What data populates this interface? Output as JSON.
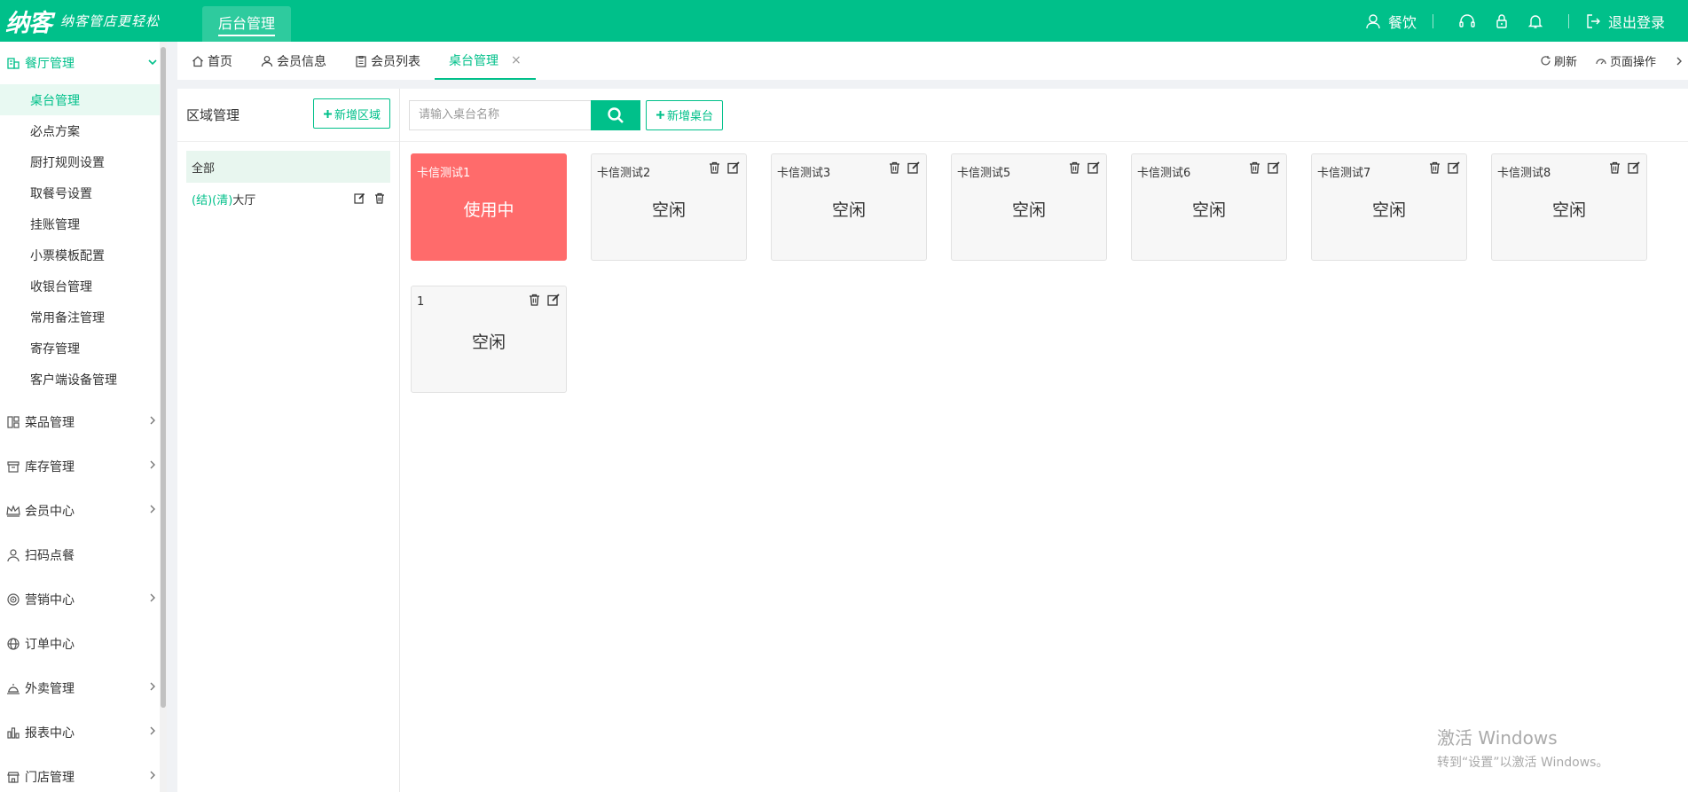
{
  "topbar": {
    "logo": "纳客",
    "slogan": "纳客管店更轻松",
    "module_tab": "后台管理",
    "user_label": "餐饮",
    "logout_label": "退出登录"
  },
  "sidebar": {
    "open_group": "餐厅管理",
    "sub_items": [
      {
        "label": "桌台管理",
        "active": true
      },
      {
        "label": "必点方案"
      },
      {
        "label": "厨打规则设置"
      },
      {
        "label": "取餐号设置"
      },
      {
        "label": "挂账管理"
      },
      {
        "label": "小票模板配置"
      },
      {
        "label": "收银台管理"
      },
      {
        "label": "常用备注管理"
      },
      {
        "label": "寄存管理"
      },
      {
        "label": "客户端设备管理"
      }
    ],
    "groups": [
      {
        "label": "菜品管理",
        "icon": "layout-icon"
      },
      {
        "label": "库存管理",
        "icon": "box-icon"
      },
      {
        "label": "会员中心",
        "icon": "crown-icon"
      },
      {
        "label": "扫码点餐",
        "icon": "person-icon"
      },
      {
        "label": "营销中心",
        "icon": "target-icon"
      },
      {
        "label": "订单中心",
        "icon": "globe-icon"
      },
      {
        "label": "外卖管理",
        "icon": "bell-dome-icon"
      },
      {
        "label": "报表中心",
        "icon": "chart-icon"
      },
      {
        "label": "门店管理",
        "icon": "store-icon"
      }
    ]
  },
  "tabs": [
    {
      "label": "首页",
      "icon": "home-icon"
    },
    {
      "label": "会员信息",
      "icon": "user-icon"
    },
    {
      "label": "会员列表",
      "icon": "clipboard-icon"
    },
    {
      "label": "桌台管理",
      "active": true,
      "close": "×"
    }
  ],
  "tabs_right": {
    "refresh": "刷新",
    "page_ops": "页面操作"
  },
  "area_panel": {
    "title": "区域管理",
    "add_button": "新增区域",
    "items": [
      {
        "label": "全部"
      },
      {
        "prefix": "(结)(清)",
        "label": "大厅"
      }
    ]
  },
  "tables_panel": {
    "search_placeholder": "请输入桌台名称",
    "add_button": "新增桌台",
    "cards": [
      {
        "name": "卡信测试1",
        "status": "使用中",
        "busy": true
      },
      {
        "name": "卡信测试2",
        "status": "空闲"
      },
      {
        "name": "卡信测试3",
        "status": "空闲"
      },
      {
        "name": "卡信测试5",
        "status": "空闲"
      },
      {
        "name": "卡信测试6",
        "status": "空闲"
      },
      {
        "name": "卡信测试7",
        "status": "空闲"
      },
      {
        "name": "卡信测试8",
        "status": "空闲"
      },
      {
        "name": "1",
        "status": "空闲"
      }
    ]
  },
  "watermark": {
    "line1": "激活 Windows",
    "line2": "转到“设置”以激活 Windows。"
  },
  "colors": {
    "brand": "#00c08a",
    "busy": "#ff6b6b"
  }
}
